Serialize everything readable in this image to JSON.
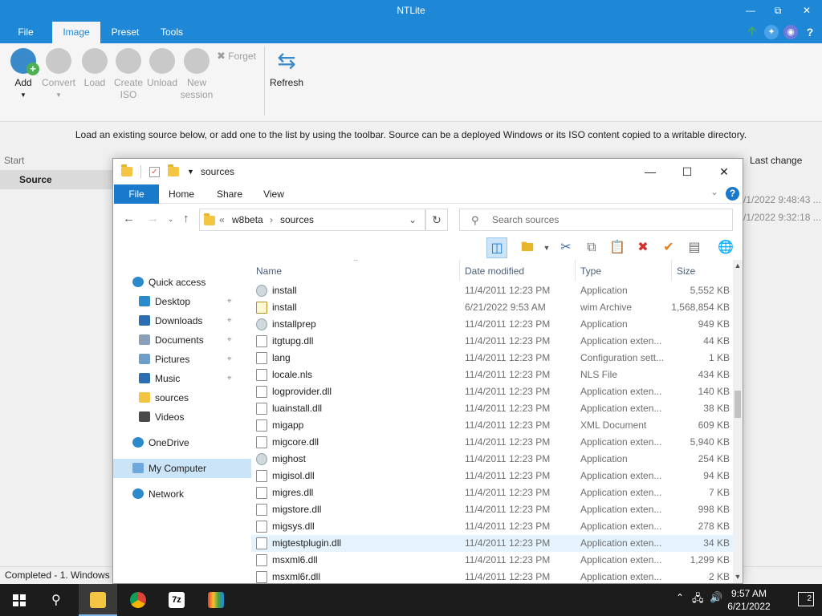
{
  "app": {
    "title": "NTLite",
    "tabs": [
      "File",
      "Image",
      "Preset",
      "Tools"
    ],
    "active_tab": "Image",
    "ribbon": {
      "add": "Add",
      "convert": "Convert",
      "load": "Load",
      "create_iso_1": "Create",
      "create_iso_2": "ISO",
      "unload": "Unload",
      "new_session_1": "New",
      "new_session_2": "session",
      "forget": "Forget",
      "refresh": "Refresh"
    },
    "hint": "Load an existing source below, or add one to the list by using the toolbar. Source can be a deployed Windows or its ISO content copied to a writable directory.",
    "list_header": {
      "start": "Start",
      "last_change": "Last change"
    },
    "source_label": "Source",
    "last_change_values": [
      "/1/2022 9:48:43 ...",
      "/1/2022 9:32:18 ..."
    ],
    "status": "Completed - 1. Windows"
  },
  "explorer": {
    "title": "sources",
    "ribbon_tabs": [
      "File",
      "Home",
      "Share",
      "View"
    ],
    "address": {
      "prefix": "«",
      "crumb1": "w8beta",
      "crumb2": "sources"
    },
    "search_placeholder": "Search sources",
    "nav": [
      {
        "label": "Quick access",
        "kind": "star",
        "pinned": false
      },
      {
        "label": "Desktop",
        "kind": "desktop",
        "pinned": true
      },
      {
        "label": "Downloads",
        "kind": "download",
        "pinned": true
      },
      {
        "label": "Documents",
        "kind": "docs",
        "pinned": true
      },
      {
        "label": "Pictures",
        "kind": "pictures",
        "pinned": true
      },
      {
        "label": "Music",
        "kind": "music",
        "pinned": true
      },
      {
        "label": "sources",
        "kind": "folder",
        "pinned": false
      },
      {
        "label": "Videos",
        "kind": "videos",
        "pinned": false
      },
      {
        "label": "OneDrive",
        "kind": "cloud",
        "pinned": false
      },
      {
        "label": "My Computer",
        "kind": "pc",
        "pinned": false,
        "selected": true
      },
      {
        "label": "Network",
        "kind": "network",
        "pinned": false
      }
    ],
    "columns": {
      "name": "Name",
      "date": "Date modified",
      "type": "Type",
      "size": "Size"
    },
    "files": [
      {
        "name": "install",
        "date": "11/4/2011 12:23 PM",
        "type": "Application",
        "size": "5,552 KB",
        "icon": "app"
      },
      {
        "name": "install",
        "date": "6/21/2022 9:53 AM",
        "type": "wim Archive",
        "size": "1,568,854 KB",
        "icon": "wim"
      },
      {
        "name": "installprep",
        "date": "11/4/2011 12:23 PM",
        "type": "Application",
        "size": "949 KB",
        "icon": "app"
      },
      {
        "name": "itgtupg.dll",
        "date": "11/4/2011 12:23 PM",
        "type": "Application exten...",
        "size": "44 KB",
        "icon": "dll"
      },
      {
        "name": "lang",
        "date": "11/4/2011 12:23 PM",
        "type": "Configuration sett...",
        "size": "1 KB",
        "icon": "cfg"
      },
      {
        "name": "locale.nls",
        "date": "11/4/2011 12:23 PM",
        "type": "NLS File",
        "size": "434 KB",
        "icon": "file"
      },
      {
        "name": "logprovider.dll",
        "date": "11/4/2011 12:23 PM",
        "type": "Application exten...",
        "size": "140 KB",
        "icon": "dll"
      },
      {
        "name": "luainstall.dll",
        "date": "11/4/2011 12:23 PM",
        "type": "Application exten...",
        "size": "38 KB",
        "icon": "dll"
      },
      {
        "name": "migapp",
        "date": "11/4/2011 12:23 PM",
        "type": "XML Document",
        "size": "609 KB",
        "icon": "xml"
      },
      {
        "name": "migcore.dll",
        "date": "11/4/2011 12:23 PM",
        "type": "Application exten...",
        "size": "5,940 KB",
        "icon": "dll"
      },
      {
        "name": "mighost",
        "date": "11/4/2011 12:23 PM",
        "type": "Application",
        "size": "254 KB",
        "icon": "app"
      },
      {
        "name": "migisol.dll",
        "date": "11/4/2011 12:23 PM",
        "type": "Application exten...",
        "size": "94 KB",
        "icon": "dll"
      },
      {
        "name": "migres.dll",
        "date": "11/4/2011 12:23 PM",
        "type": "Application exten...",
        "size": "7 KB",
        "icon": "dll"
      },
      {
        "name": "migstore.dll",
        "date": "11/4/2011 12:23 PM",
        "type": "Application exten...",
        "size": "998 KB",
        "icon": "dll"
      },
      {
        "name": "migsys.dll",
        "date": "11/4/2011 12:23 PM",
        "type": "Application exten...",
        "size": "278 KB",
        "icon": "dll"
      },
      {
        "name": "migtestplugin.dll",
        "date": "11/4/2011 12:23 PM",
        "type": "Application exten...",
        "size": "34 KB",
        "icon": "dll",
        "highlight": true
      },
      {
        "name": "msxml6.dll",
        "date": "11/4/2011 12:23 PM",
        "type": "Application exten...",
        "size": "1,299 KB",
        "icon": "dll"
      },
      {
        "name": "msxml6r.dll",
        "date": "11/4/2011 12:23 PM",
        "type": "Application exten...",
        "size": "2 KB",
        "icon": "dll"
      }
    ]
  },
  "taskbar": {
    "time": "9:57 AM",
    "date": "6/21/2022",
    "notification_count": "2",
    "apps": [
      "file-explorer",
      "chrome",
      "7zip",
      "ntlite"
    ],
    "archive_app_label": "7z"
  },
  "colors": {
    "accent": "#1e88d6",
    "explorer_accent": "#1979ca",
    "taskbar": "#1c1c1c"
  }
}
